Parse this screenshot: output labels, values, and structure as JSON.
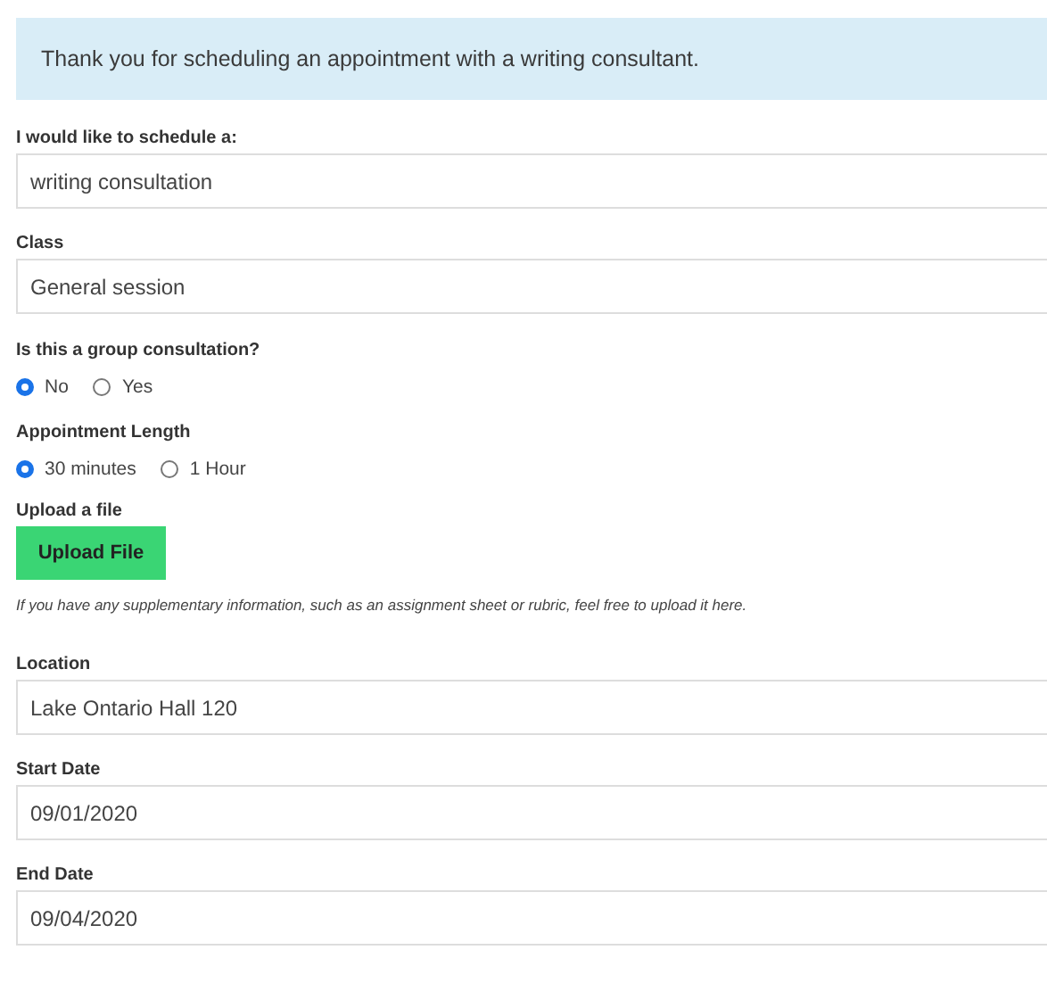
{
  "banner": {
    "text": "Thank you for scheduling an appointment with a writing consultant."
  },
  "sections": [
    {
      "kind": "field",
      "label": "I would like to schedule a:",
      "value": "writing consultation"
    },
    {
      "kind": "field",
      "label": "Class",
      "value": "General session"
    },
    {
      "kind": "radio",
      "label": "Is this a group consultation?",
      "options": [
        {
          "label": "No",
          "selected": true
        },
        {
          "label": "Yes",
          "selected": false
        }
      ]
    },
    {
      "kind": "radio",
      "label": "Appointment Length",
      "options": [
        {
          "label": "30 minutes",
          "selected": true
        },
        {
          "label": "1 Hour",
          "selected": false
        }
      ]
    },
    {
      "kind": "upload",
      "label": "Upload a file",
      "button": "Upload File",
      "note": "If you have any supplementary information, such as an assignment sheet or rubric, feel free to upload it here."
    },
    {
      "kind": "field",
      "label": "Location",
      "value": "Lake Ontario Hall 120"
    },
    {
      "kind": "field",
      "label": "Start Date",
      "value": "09/01/2020"
    },
    {
      "kind": "field",
      "label": "End Date",
      "value": "09/04/2020"
    }
  ]
}
